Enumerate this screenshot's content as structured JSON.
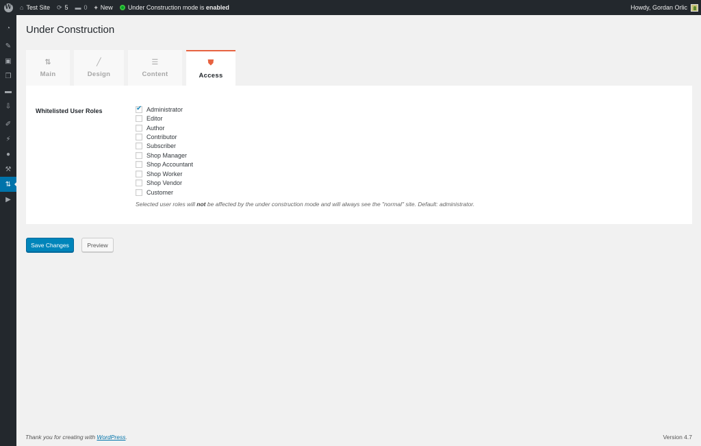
{
  "adminbar": {
    "site_name": "Test Site",
    "updates_count": "5",
    "comments_count": "0",
    "new_label": "New",
    "uc_status_prefix": "Under Construction mode is ",
    "uc_status_value": "enabled",
    "greeting": "Howdy, Gordan Orlic"
  },
  "sidemenu": {
    "items": [
      {
        "icon": "dashboard-icon",
        "glyph": "◔"
      },
      {
        "icon": "posts-icon",
        "glyph": "✎"
      },
      {
        "icon": "media-icon",
        "glyph": "▣"
      },
      {
        "icon": "pages-icon",
        "glyph": "❐"
      },
      {
        "icon": "comments-icon",
        "glyph": "▬"
      },
      {
        "icon": "feedback-icon",
        "glyph": "⇩"
      },
      {
        "icon": "appearance-icon",
        "glyph": "✐"
      },
      {
        "icon": "plugins-icon",
        "glyph": "⚡"
      },
      {
        "icon": "users-icon",
        "glyph": "●"
      },
      {
        "icon": "tools-icon",
        "glyph": "⚒"
      },
      {
        "icon": "under-construction-icon",
        "glyph": "⇅",
        "current": true
      },
      {
        "icon": "collapse-icon",
        "glyph": "▶"
      }
    ]
  },
  "page": {
    "title": "Under Construction"
  },
  "tabs": [
    {
      "label": "Main",
      "icon": "main-icon",
      "glyph": "⇅"
    },
    {
      "label": "Design",
      "icon": "brush-icon",
      "glyph": "╱"
    },
    {
      "label": "Content",
      "icon": "document-icon",
      "glyph": "☰"
    },
    {
      "label": "Access",
      "icon": "shield-icon",
      "glyph": "⛊",
      "active": true
    }
  ],
  "access": {
    "field_label": "Whitelisted User Roles",
    "roles": [
      {
        "label": "Administrator",
        "checked": true
      },
      {
        "label": "Editor",
        "checked": false
      },
      {
        "label": "Author",
        "checked": false
      },
      {
        "label": "Contributor",
        "checked": false
      },
      {
        "label": "Subscriber",
        "checked": false
      },
      {
        "label": "Shop Manager",
        "checked": false
      },
      {
        "label": "Shop Accountant",
        "checked": false
      },
      {
        "label": "Shop Worker",
        "checked": false
      },
      {
        "label": "Shop Vendor",
        "checked": false
      },
      {
        "label": "Customer",
        "checked": false
      }
    ],
    "description_before": "Selected user roles will ",
    "description_bold": "not",
    "description_after": " be affected by the under construction mode and will always see the \"normal\" site. Default: administrator."
  },
  "buttons": {
    "save": "Save Changes",
    "preview": "Preview"
  },
  "footer": {
    "thanks_prefix": "Thank you for creating with ",
    "wordpress_link": "WordPress",
    "thanks_suffix": ".",
    "version": "Version 4.7"
  }
}
